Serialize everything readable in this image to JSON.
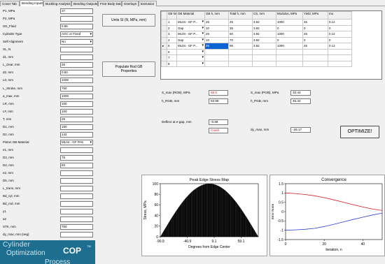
{
  "tabs": [
    "Cover Tab",
    "Bending Inputs",
    "Buckling Analysis",
    "Bending Outputs",
    "Free Body Data",
    "Overlays",
    "Extrusion"
  ],
  "active_tab": "Bending Inputs",
  "inputs": [
    {
      "label": "P1, MPa",
      "value": "37",
      "type": "text"
    },
    {
      "label": "P2, MPa",
      "value": "",
      "type": "text"
    },
    {
      "label": "SG_Fluid",
      "value": "0.85",
      "type": "text"
    },
    {
      "label": "Cylinder Type",
      "value": "AGC or Fixed",
      "type": "select"
    },
    {
      "label": "Self Alignment",
      "value": "No",
      "type": "select"
    },
    {
      "label": "SL, N",
      "value": "",
      "type": "text"
    },
    {
      "label": "d1, mm",
      "value": "",
      "type": "text"
    },
    {
      "label": "L_clear, mm",
      "value": "25",
      "type": "text"
    },
    {
      "label": "d2, mm",
      "value": "0.50",
      "type": "text"
    },
    {
      "label": "L0, mm",
      "value": "1000",
      "type": "text"
    },
    {
      "label": "L_Stroke, mm",
      "value": "750",
      "type": "text"
    },
    {
      "label": "a_max, mm",
      "value": "1000",
      "type": "text"
    },
    {
      "label": "LR, mm",
      "value": "100",
      "type": "text"
    },
    {
      "label": "LF, mm",
      "value": "100",
      "type": "text"
    },
    {
      "label": "T, mm",
      "value": "25",
      "type": "text"
    },
    {
      "label": "D1, mm",
      "value": "150",
      "type": "text"
    },
    {
      "label": "D2, mm",
      "value": "142",
      "type": "text"
    },
    {
      "label": "Piston GB Material",
      "value": "ML04 - GF PA6",
      "type": "select"
    },
    {
      "label": "e1, mm",
      "value": "",
      "type": "text"
    },
    {
      "label": "D3, mm",
      "value": "75",
      "type": "text"
    },
    {
      "label": "D4, mm",
      "value": "83",
      "type": "text"
    },
    {
      "label": "e2, mm",
      "value": "",
      "type": "text"
    },
    {
      "label": "D5, mm",
      "value": "",
      "type": "text"
    },
    {
      "label": "L_trans, mm",
      "value": "",
      "type": "text"
    },
    {
      "label": "Bd_cyl, mm",
      "value": "",
      "type": "text"
    },
    {
      "label": "Bd_rod, mm",
      "value": "",
      "type": "text"
    },
    {
      "label": "y1",
      "value": "",
      "type": "text"
    },
    {
      "label": "a2",
      "value": "",
      "type": "text"
    },
    {
      "label": "STK, mm",
      "value": "750",
      "type": "text"
    },
    {
      "label": "dy_max, mm (neg)",
      "value": "",
      "type": "text"
    }
  ],
  "brand": {
    "line1": "Cylinder",
    "line2": "Optimization",
    "line3": "Process",
    "logo": "COP",
    "tm": "TM"
  },
  "buttons": {
    "units": "Units SI (N, MPa, mm)",
    "populate": "Populate Rod GB Properties",
    "optimize": "OPTIMIZE!"
  },
  "grid": {
    "headers": [
      "",
      "GB Num",
      "GB Material",
      "GB h, mm",
      "Total h, mm",
      "CS, mm",
      "Modulus, MPa",
      "Yield, MPa",
      "mu"
    ],
    "rows": [
      [
        "",
        "1",
        "ML04 - GF P...",
        "25",
        "25",
        "3.92",
        "1000",
        "45",
        "0.12"
      ],
      [
        "",
        "2",
        "Gap",
        "10",
        "35",
        "3.92",
        "0",
        "0",
        "0"
      ],
      [
        "",
        "3",
        "ML04 - GF P...",
        "25",
        "60",
        "3.92",
        "1000",
        "45",
        "0.12"
      ],
      [
        "",
        "4",
        "Gap",
        "10",
        "70",
        "3.92",
        "0",
        "0",
        "0"
      ],
      [
        "▸",
        "5",
        "ML04 - GF P...",
        "25",
        "95",
        "3.92",
        "1000",
        "45",
        "0.12"
      ],
      [
        "",
        "6",
        "",
        "",
        "",
        "",
        "",
        "",
        ""
      ],
      [
        "",
        "7",
        "",
        "",
        "",
        "",
        "",
        "",
        ""
      ],
      [
        "",
        "8",
        "",
        "",
        "",
        "",
        "",
        "",
        ""
      ]
    ]
  },
  "results": {
    "s_max_rgb_label": "S_max (RGB), MPa",
    "s_max_rgb": "55.0",
    "h_rgb_label": "h_RGB, mm",
    "h_rgb": "53.98",
    "s_max_pgb_label": "S_max (PGB), MPa",
    "s_max_pgb": "33.44",
    "h_pgb_label": "h_PGB, mm",
    "h_pgb": "46.34",
    "deflect_label": "Deflect at e-gap, mm",
    "deflect": "-0.68",
    "crash": "Crash",
    "dy_max_label": "dy_max, mm",
    "dy_max": "-26.17"
  },
  "colors": {
    "brand": "#1e6f8f",
    "alert": "#d21c1c",
    "selection": "#0a64d6",
    "error_red": "#d21c1c",
    "error_blue": "#2a3fd0"
  },
  "chart_data": [
    {
      "type": "area",
      "title": "Peak Edge Stress Map",
      "xlabel": "Degrees from Edge Center",
      "ylabel": "Stress, MPa",
      "xlim": [
        -90.9,
        90.9
      ],
      "ylim": [
        0,
        100
      ],
      "xticks": [
        "-90.9",
        "-40.9",
        "9.1",
        "59.1"
      ],
      "yticks": [
        "0",
        "20",
        "40",
        "60",
        "80",
        "100"
      ],
      "peak": 100,
      "x": [
        -90.9,
        -72.7,
        -54.5,
        -36.4,
        -18.2,
        0,
        18.2,
        36.4,
        54.5,
        72.7,
        90.9
      ],
      "y": [
        0,
        31,
        59,
        81,
        95,
        100,
        95,
        81,
        59,
        31,
        0
      ],
      "grid": false
    },
    {
      "type": "line",
      "title": "Convergence",
      "xlabel": "iteration, n",
      "ylabel": "Error Norm",
      "xlim": [
        0,
        50
      ],
      "ylim": [
        -1.5,
        1.5
      ],
      "xticks": [
        "0",
        "20",
        "40"
      ],
      "yticks": [
        "-1.5",
        "-1",
        "-0.5",
        "0",
        "0.5",
        "1",
        "1.5"
      ],
      "series": [
        {
          "color": "#d21c1c",
          "x": [
            0,
            5,
            10,
            15,
            20,
            25,
            30,
            35,
            40,
            45,
            50
          ],
          "y": [
            1.0,
            0.97,
            0.92,
            0.85,
            0.75,
            0.63,
            0.5,
            0.37,
            0.25,
            0.14,
            0.06
          ]
        },
        {
          "color": "#2a3fd0",
          "x": [
            0,
            5,
            10,
            15,
            20,
            25,
            30,
            35,
            40,
            45,
            50
          ],
          "y": [
            -1.0,
            -0.98,
            -0.95,
            -0.9,
            -0.8,
            -0.68,
            -0.55,
            -0.42,
            -0.3,
            -0.18,
            -0.08
          ]
        }
      ],
      "grid": false
    }
  ]
}
